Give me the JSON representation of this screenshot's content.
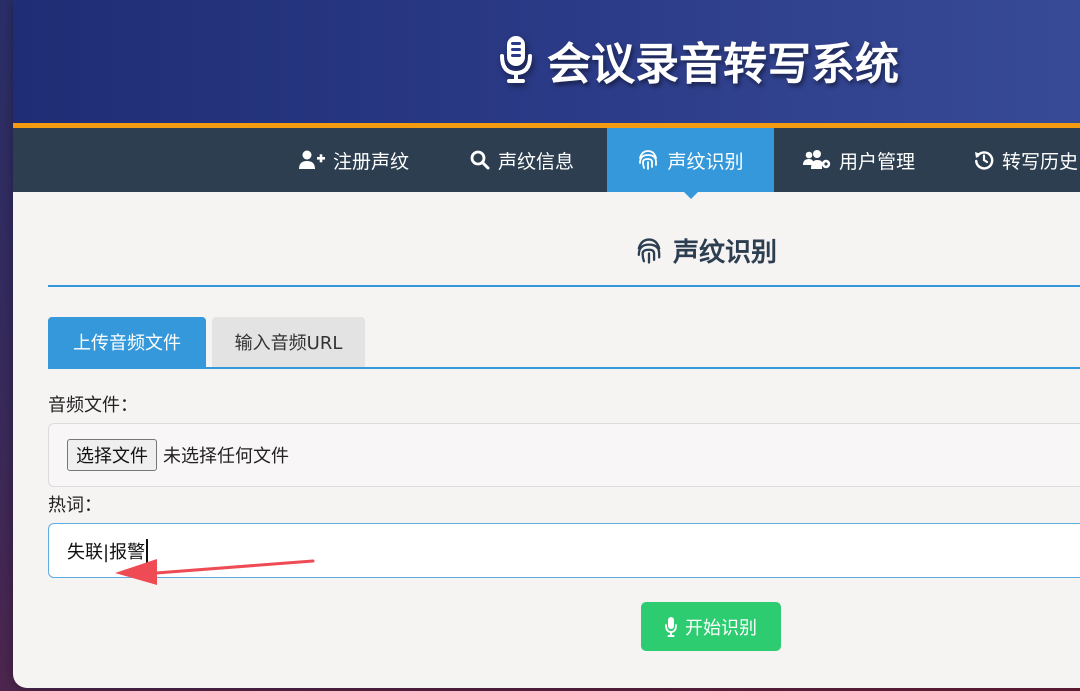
{
  "header": {
    "title": "会议录音转写系统",
    "icon": "microphone-icon"
  },
  "nav": {
    "items": [
      {
        "label": "注册声纹",
        "icon": "user-plus-icon",
        "active": false
      },
      {
        "label": "声纹信息",
        "icon": "search-icon",
        "active": false
      },
      {
        "label": "声纹识别",
        "icon": "fingerprint-icon",
        "active": true
      },
      {
        "label": "用户管理",
        "icon": "users-cog-icon",
        "active": false
      },
      {
        "label": "转写历史",
        "icon": "history-icon",
        "active": false
      }
    ]
  },
  "section": {
    "title": "声纹识别",
    "icon": "fingerprint-icon"
  },
  "tabs": [
    {
      "label": "上传音频文件",
      "active": true
    },
    {
      "label": "输入音频URL",
      "active": false
    }
  ],
  "form": {
    "audio_label": "音频文件：",
    "file_button": "选择文件",
    "file_status": "未选择任何文件",
    "hotword_label": "热词：",
    "hotword_value": "失联|报警"
  },
  "start_button": {
    "label": "开始识别",
    "icon": "microphone-icon"
  },
  "colors": {
    "header_bg": "#2b3a86",
    "accent_orange": "#f39c12",
    "nav_bg": "#2c3e50",
    "active_blue": "#3498db",
    "start_green": "#2ecc71",
    "annotation_arrow": "#ef4b55"
  }
}
